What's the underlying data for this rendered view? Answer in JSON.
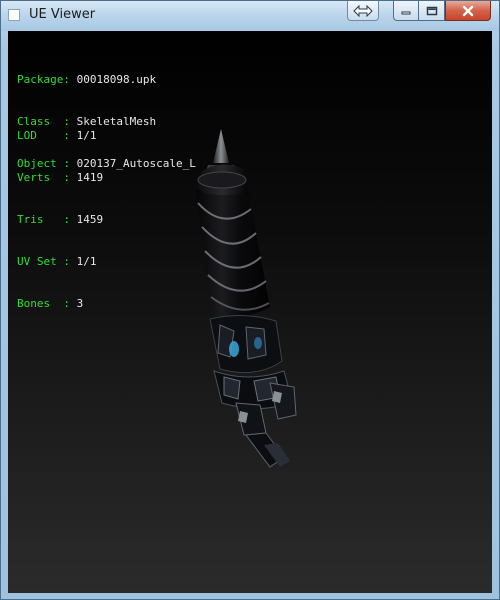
{
  "window": {
    "title": "UE Viewer"
  },
  "info": {
    "asset": [
      {
        "label": "Package: ",
        "value": "00018098.upk"
      },
      {
        "label": "Class  : ",
        "value": "SkeletalMesh"
      },
      {
        "label": "Object : ",
        "value": "020137_Autoscale_L"
      }
    ],
    "stats": [
      {
        "label": "LOD    : ",
        "value": "1/1"
      },
      {
        "label": "Verts  : ",
        "value": "1419"
      },
      {
        "label": "Tris   : ",
        "value": "1459"
      },
      {
        "label": "UV Set : ",
        "value": "1/1"
      },
      {
        "label": "Bones  : ",
        "value": "3"
      }
    ]
  },
  "colors": {
    "label_green": "#33dd33",
    "value_white": "#e8e8e8",
    "viewport_bg": "#000000",
    "close_red": "#c7452b"
  },
  "icons": {
    "app": "app-icon",
    "restore_arrows": "double-arrow-icon",
    "minimize": "minimize-icon",
    "maximize": "maximize-icon",
    "close": "close-icon"
  }
}
